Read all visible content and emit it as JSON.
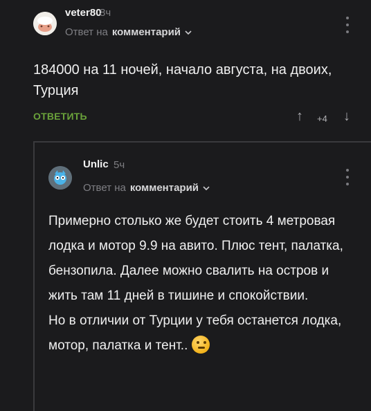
{
  "comment1": {
    "username": "veter80",
    "time": "8ч",
    "reply_prefix": "Ответ на",
    "reply_target": "комментарий",
    "text": "184000 на 11 ночей, начало августа, на двоих, Турция",
    "answer_label": "ОТВЕТИТЬ",
    "score": "+4"
  },
  "comment2": {
    "username": "Unlic",
    "time": "5ч",
    "reply_prefix": "Ответ на",
    "reply_target": "комментарий",
    "paragraphs": [
      "Примерно столько же будет стоить 4 метровая лодка и мотор 9.9 на авито. Плюс тент, палатка, бензопила. Далее можно свалить на остров и жить там 11 дней в тишине и спокойствии.",
      "Но в отличии от Турции у тебя останется лодка, мотор, палатка и тент.."
    ]
  },
  "icons": {
    "up": "arrow-up-icon",
    "down": "arrow-down-icon",
    "more": "kebab-menu-icon",
    "chevron": "chevron-down-icon",
    "emoji": "thinking-face-emoji"
  },
  "colors": {
    "background": "#1b1b1d",
    "accent_green": "#6aa23a"
  }
}
